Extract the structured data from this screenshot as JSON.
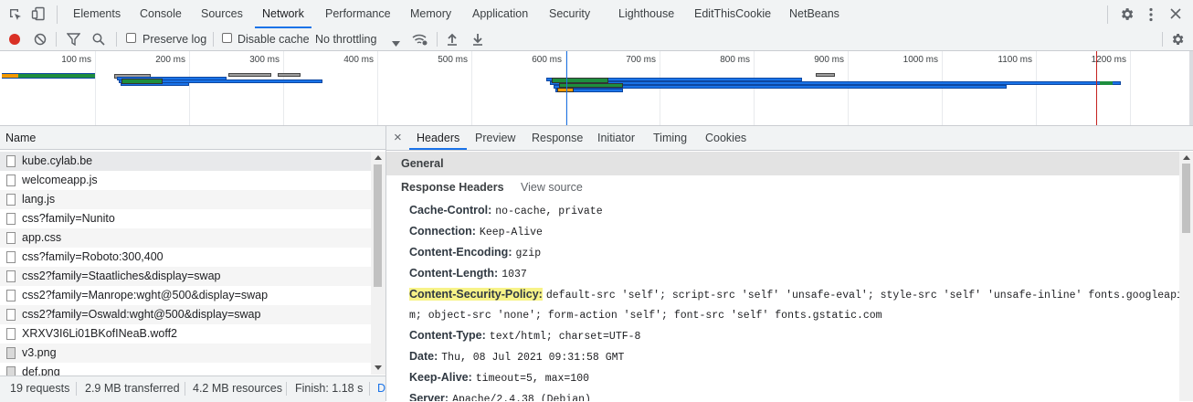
{
  "main_tabs": [
    "Elements",
    "Console",
    "Sources",
    "Network",
    "Performance",
    "Memory",
    "Application",
    "Security",
    "Lighthouse",
    "EditThisCookie",
    "NetBeans"
  ],
  "active_main_tab": "Network",
  "toolbar": {
    "preserve_log_label": "Preserve log",
    "preserve_log_checked": false,
    "disable_cache_label": "Disable cache",
    "disable_cache_checked": false,
    "throttling_value": "No throttling"
  },
  "timeline": {
    "ticks": [
      "100 ms",
      "200 ms",
      "300 ms",
      "400 ms",
      "500 ms",
      "600 ms",
      "700 ms",
      "800 ms",
      "900 ms",
      "1000 ms",
      "1100 ms",
      "1200 ms"
    ]
  },
  "requests": {
    "column_header": "Name",
    "items": [
      {
        "name": "kube.cylab.be",
        "type": "document"
      },
      {
        "name": "welcomeapp.js",
        "type": "document"
      },
      {
        "name": "lang.js",
        "type": "document"
      },
      {
        "name": "css?family=Nunito",
        "type": "document"
      },
      {
        "name": "app.css",
        "type": "document"
      },
      {
        "name": "css?family=Roboto:300,400",
        "type": "document"
      },
      {
        "name": "css2?family=Staatliches&display=swap",
        "type": "document"
      },
      {
        "name": "css2?family=Manrope:wght@500&display=swap",
        "type": "document"
      },
      {
        "name": "css2?family=Oswald:wght@500&display=swap",
        "type": "document"
      },
      {
        "name": "XRXV3I6Li01BKofINeaB.woff2",
        "type": "document"
      },
      {
        "name": "v3.png",
        "type": "image"
      },
      {
        "name": "def.png",
        "type": "image"
      }
    ],
    "selected_index": 0
  },
  "status_bar": {
    "requests": "19 requests",
    "transferred": "2.9 MB transferred",
    "resources": "4.2 MB resources",
    "finish": "Finish: 1.18 s",
    "overflow": "D"
  },
  "detail": {
    "close_symbol": "×",
    "tabs": [
      "Headers",
      "Preview",
      "Response",
      "Initiator",
      "Timing",
      "Cookies"
    ],
    "active_tab": "Headers",
    "general_label": "General",
    "response_headers_label": "Response Headers",
    "view_source_label": "View source",
    "headers": [
      {
        "key": "Cache-Control:",
        "value": "no-cache, private"
      },
      {
        "key": "Connection:",
        "value": "Keep-Alive"
      },
      {
        "key": "Content-Encoding:",
        "value": "gzip"
      },
      {
        "key": "Content-Length:",
        "value": "1037"
      },
      {
        "key": "Content-Security-Policy:",
        "value": "default-src 'self'; script-src 'self' 'unsafe-eval'; style-src 'self' 'unsafe-inline' fonts.googleapis.co",
        "value_cont": "m; object-src 'none'; form-action 'self'; font-src  'self'  fonts.gstatic.com",
        "highlighted": true
      },
      {
        "key": "Content-Type:",
        "value": "text/html; charset=UTF-8"
      },
      {
        "key": "Date:",
        "value": "Thu, 08 Jul 2021 09:31:58 GMT"
      },
      {
        "key": "Keep-Alive:",
        "value": "timeout=5, max=100"
      },
      {
        "key": "Server:",
        "value": "Apache/2.4.38 (Debian)"
      }
    ]
  },
  "colors": {
    "accent": "#1a73e8",
    "record": "#d93025",
    "highlight": "#f7f388",
    "waiting": "#009688",
    "receiving": "#1a73e8"
  }
}
